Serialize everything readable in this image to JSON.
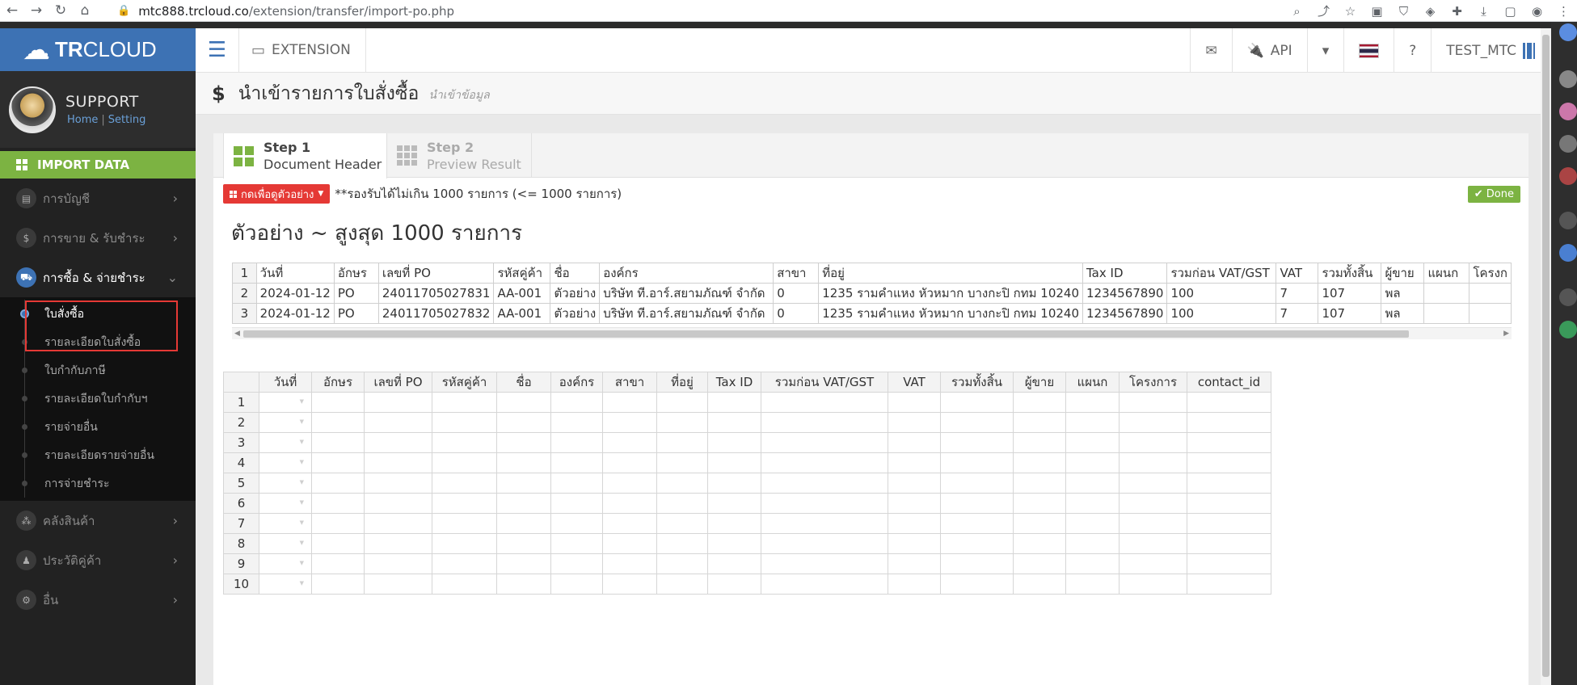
{
  "browser": {
    "url_host": "mtc888.trcloud.co",
    "url_path": "/extension/transfer/import-po.php"
  },
  "sidebar": {
    "logo_bold": "TR",
    "logo_rest": "CLOUD",
    "profile_name": "SUPPORT",
    "home_link": "Home",
    "setting_link": "Setting",
    "import_data": "IMPORT DATA",
    "menu": [
      {
        "label": "การบัญชี",
        "icon": "book-icon"
      },
      {
        "label": "การขาย & รับชำระ",
        "icon": "dollar-icon"
      },
      {
        "label": "การซื้อ & จ่ายชำระ",
        "icon": "cart-icon"
      },
      {
        "label": "คลังสินค้า",
        "icon": "boxes-icon"
      },
      {
        "label": "ประวัติคู่ค้า",
        "icon": "person-icon"
      },
      {
        "label": "อื่น",
        "icon": "gear-icon"
      }
    ],
    "submenu": [
      "ใบสั่งซื้อ",
      "รายละเอียดใบสั่งซื้อ",
      "ใบกำกับภาษี",
      "รายละเอียดใบกำกับฯ",
      "รายจ่ายอื่น",
      "รายละเอียดรายจ่ายอื่น",
      "การจ่ายชำระ"
    ]
  },
  "topnav": {
    "extension": "EXTENSION",
    "api": "API",
    "user": "TEST_MTC"
  },
  "page": {
    "title": "นำเข้ารายการใบสั่งซื้อ",
    "subtitle": "นำเข้าข้อมูล"
  },
  "steps": [
    {
      "title": "Step 1",
      "sub": "Document Header"
    },
    {
      "title": "Step 2",
      "sub": "Preview Result"
    }
  ],
  "toolbar": {
    "example_button": "กดเพื่อดูตัวอย่าง",
    "note": "**รองรับได้ไม่เกิน 1000 รายการ (<= 1000 รายการ)",
    "done": "Done"
  },
  "example": {
    "title": "ตัวอย่าง ~ สูงสุด 1000 รายการ",
    "rows": [
      [
        "วันที่",
        "อักษร",
        "เลขที่ PO",
        "รหัสคู่ค้า",
        "ชื่อ",
        "องค์กร",
        "สาขา",
        "ที่อยู่",
        "Tax ID",
        "รวมก่อน VAT/GST",
        "VAT",
        "รวมทั้งสิ้น",
        "ผู้ขาย",
        "แผนก",
        "โครงก"
      ],
      [
        "2024-01-12",
        "PO",
        "24011705027831",
        "AA-001",
        "ตัวอย่าง",
        "บริษัท ที.อาร์.สยามภัณฑ์ จำกัด",
        "0",
        "1235 รามคำแหง หัวหมาก บางกะปิ กทม 10240",
        "1234567890",
        "100",
        "7",
        "107",
        "พล",
        "",
        ""
      ],
      [
        "2024-01-12",
        "PO",
        "24011705027832",
        "AA-001",
        "ตัวอย่าง",
        "บริษัท ที.อาร์.สยามภัณฑ์ จำกัด",
        "0",
        "1235 รามคำแหง หัวหมาก บางกะปิ กทม 10240",
        "1234567890",
        "100",
        "7",
        "107",
        "พล",
        "",
        ""
      ]
    ]
  },
  "grid": {
    "headers": [
      "วันที่",
      "อักษร",
      "เลขที่ PO",
      "รหัสคู่ค้า",
      "ชื่อ",
      "องค์กร",
      "สาขา",
      "ที่อยู่",
      "Tax ID",
      "รวมก่อน VAT/GST",
      "VAT",
      "รวมทั้งสิ้น",
      "ผู้ขาย",
      "แผนก",
      "โครงการ",
      "contact_id"
    ],
    "row_numbers": [
      "1",
      "2",
      "3",
      "4",
      "5",
      "6",
      "7",
      "8",
      "9",
      "10"
    ]
  },
  "colors": {
    "brand_blue": "#3d72b4",
    "import_green": "#7cb342",
    "example_red": "#e53935"
  }
}
